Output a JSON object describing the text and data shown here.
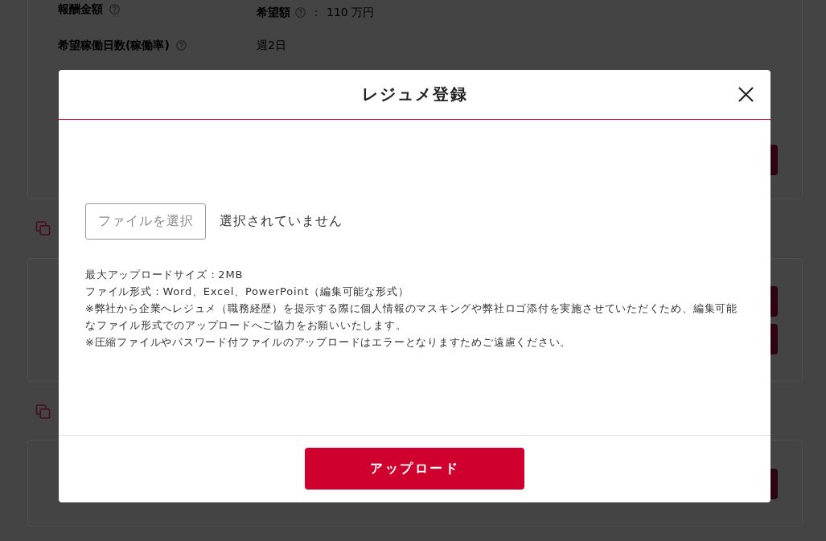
{
  "background": {
    "profile_rows": [
      {
        "kind": "amount",
        "label": "報酬金額",
        "sub_label": "希望額",
        "separator": "：",
        "value": "110 万円"
      },
      {
        "kind": "text",
        "label": "希望稼働日数(稼働率)",
        "value": "週2日"
      }
    ]
  },
  "modal": {
    "title": "レジュメ登録",
    "file_input": {
      "button_label": "ファイルを選択",
      "status": "選択されていません"
    },
    "notes": [
      "最大アップロードサイズ：2MB",
      "ファイル形式：Word、Excel、PowerPoint（編集可能な形式）",
      "※弊社から企業へレジュメ（職務経歴）を提示する際に個人情報のマスキングや弊社ロゴ添付を実施させていただくため、編集可能なファイル形式でのアップロードへご協力をお願いいたします。",
      "※圧縮ファイルやパスワード付ファイルのアップロードはエラーとなりますためご遠慮ください。"
    ],
    "submit_label": "アップロード"
  }
}
